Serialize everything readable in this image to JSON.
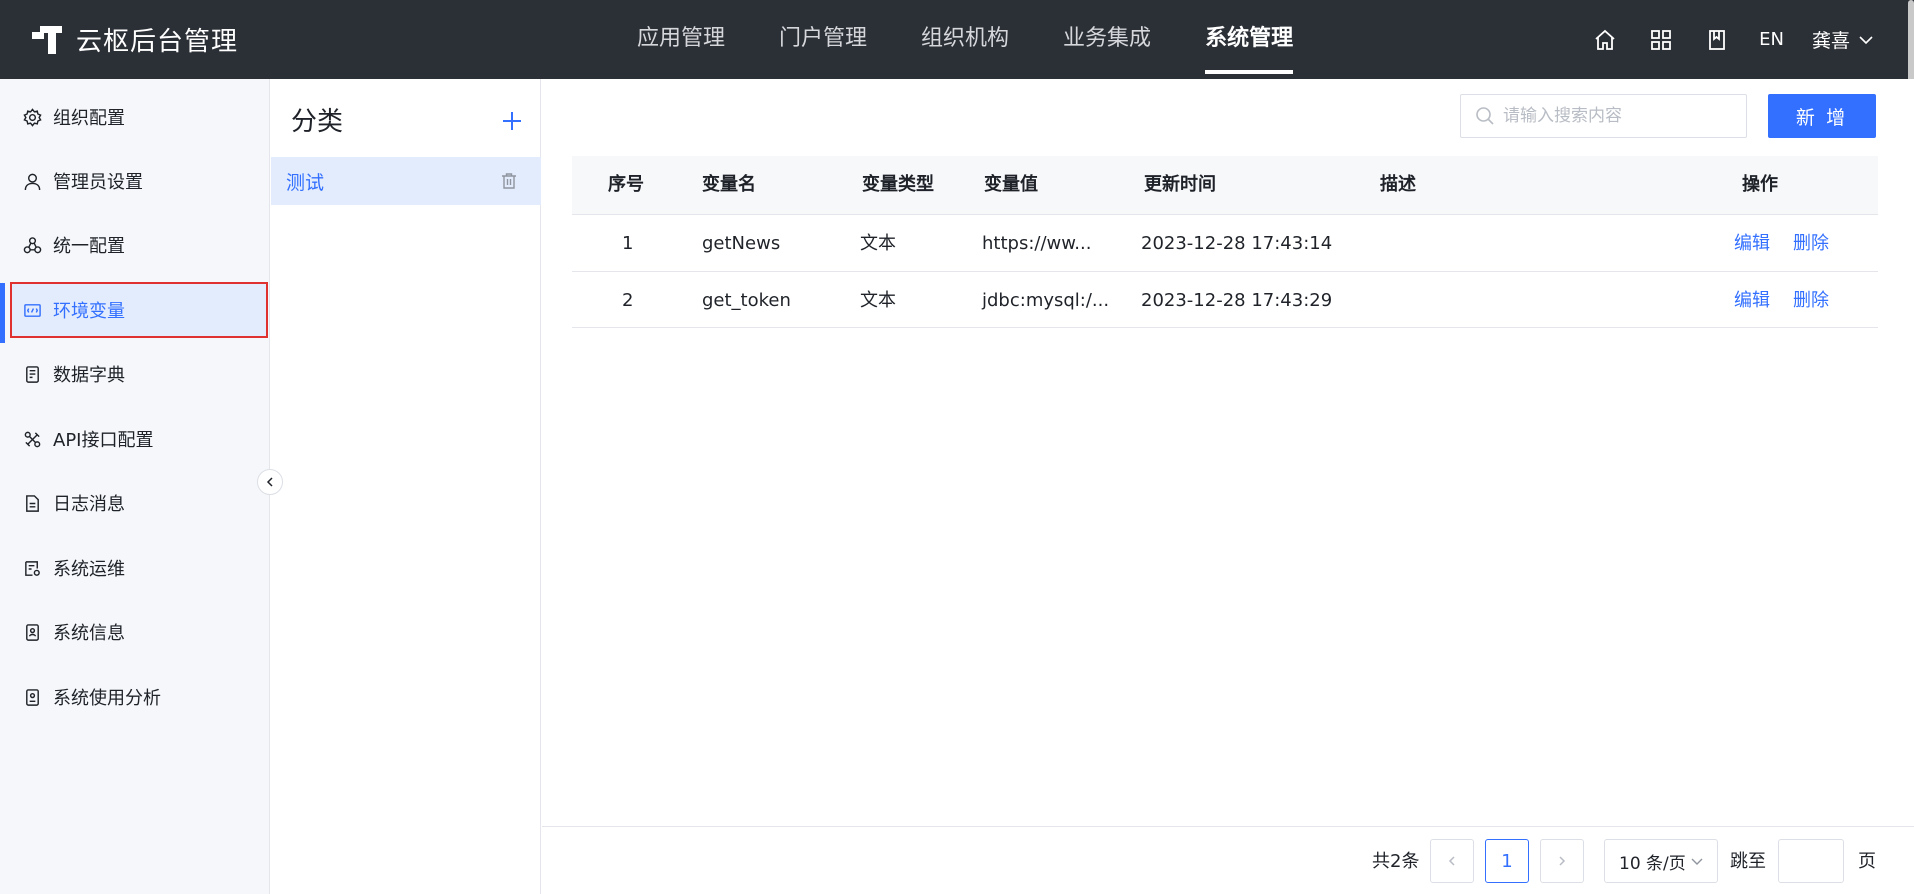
{
  "app": {
    "title": "云枢后台管理"
  },
  "topnav": {
    "items": [
      {
        "label": "应用管理"
      },
      {
        "label": "门户管理"
      },
      {
        "label": "组织机构"
      },
      {
        "label": "业务集成"
      },
      {
        "label": "系统管理",
        "active": true
      }
    ]
  },
  "header": {
    "lang": "EN",
    "user": "龚喜"
  },
  "sidebar": {
    "items": [
      {
        "label": "组织配置",
        "icon": "gear-icon"
      },
      {
        "label": "管理员设置",
        "icon": "user-icon"
      },
      {
        "label": "统一配置",
        "icon": "cluster-icon"
      },
      {
        "label": "环境变量",
        "icon": "variable-icon",
        "active": true
      },
      {
        "label": "数据字典",
        "icon": "dictionary-icon"
      },
      {
        "label": "API接口配置",
        "icon": "api-icon"
      },
      {
        "label": "日志消息",
        "icon": "document-icon"
      },
      {
        "label": "系统运维",
        "icon": "maintenance-icon"
      },
      {
        "label": "系统信息",
        "icon": "info-card-icon"
      },
      {
        "label": "系统使用分析",
        "icon": "analysis-icon"
      }
    ]
  },
  "category": {
    "title": "分类",
    "items": [
      {
        "label": "测试"
      }
    ]
  },
  "toolbar": {
    "search_placeholder": "请输入搜索内容",
    "add_label": "新 增"
  },
  "table": {
    "columns": [
      "序号",
      "变量名",
      "变量类型",
      "变量值",
      "更新时间",
      "描述",
      "操作"
    ],
    "rows": [
      {
        "index": "1",
        "name": "getNews",
        "type": "文本",
        "value": "https://ww...",
        "updated": "2023-12-28 17:43:14",
        "desc": "",
        "edit": "编辑",
        "delete": "删除"
      },
      {
        "index": "2",
        "name": "get_token",
        "type": "文本",
        "value": "jdbc:mysql:/...",
        "updated": "2023-12-28 17:43:29",
        "desc": "",
        "edit": "编辑",
        "delete": "删除"
      }
    ]
  },
  "pagination": {
    "total": "共2条",
    "current": "1",
    "page_size": "10 条/页",
    "jump_label": "跳至",
    "page_label": "页"
  }
}
